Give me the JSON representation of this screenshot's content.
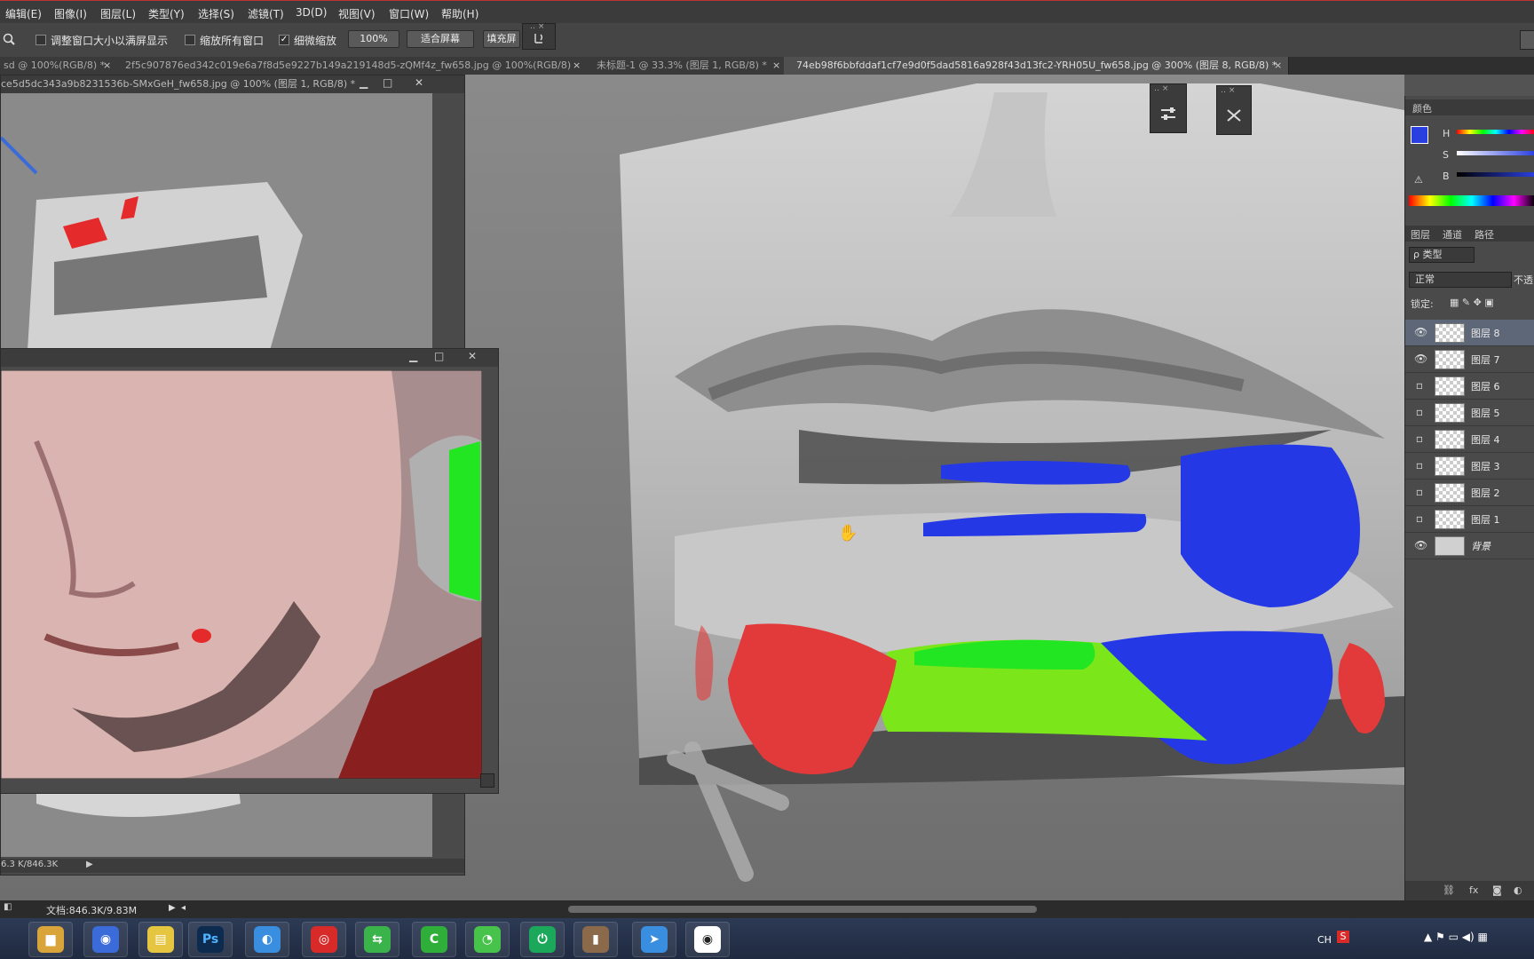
{
  "menu": [
    "编辑(E)",
    "图像(I)",
    "图层(L)",
    "类型(Y)",
    "选择(S)",
    "滤镜(T)",
    "3D(D)",
    "视图(V)",
    "窗口(W)",
    "帮助(H)"
  ],
  "options": {
    "zoom_icon": "zoom-icon",
    "resize_windows": {
      "label": "调整窗口大小以满屏显示",
      "checked": false
    },
    "zoom_all_windows": {
      "label": "缩放所有窗口",
      "checked": false
    },
    "scrubby_zoom": {
      "label": "细微缩放",
      "checked": true
    },
    "zoom_value": "100%",
    "fit_screen": "适合屏幕",
    "fill_screen": "填充屏"
  },
  "tabs": [
    {
      "label": "sd @ 100%(RGB/8) *",
      "close": "×"
    },
    {
      "label": "2f5c907876ed342c019e6a7f8d5e9227b149a219148d5-zQMf4z_fw658.jpg @ 100%(RGB/8)",
      "close": "×"
    },
    {
      "label": "未标题-1 @ 33.3% (图层 1, RGB/8) *",
      "close": "×"
    },
    {
      "label": "74eb98f6bbfddaf1cf7e9d0f5dad5816a928f43d13fc2-YRH05U_fw658.jpg @ 300% (图层 8, RGB/8) *",
      "close": "×"
    }
  ],
  "float_window_1": {
    "title": "ce5d5dc343a9b8231536b-SMxGeH_fw658.jpg @ 100% (图层 1, RGB/8) *",
    "status": "6.3 K/846.3K"
  },
  "float_window_2": {
    "title": ""
  },
  "color_panel": {
    "title": "颜色",
    "channels": [
      "H",
      "S",
      "B"
    ],
    "foreground": "#2a3fe0",
    "background": "#ffffff"
  },
  "layers_panel": {
    "tabs": [
      "图层",
      "通道",
      "路径"
    ],
    "filter": "ρ 类型",
    "blend_mode": "正常",
    "opacity_label": "不透",
    "lock_label": "锁定:",
    "layers": [
      {
        "name": "图层 8",
        "visible": true,
        "selected": true
      },
      {
        "name": "图层 7",
        "visible": true,
        "selected": false
      },
      {
        "name": "图层 6",
        "visible": false,
        "selected": false
      },
      {
        "name": "图层 5",
        "visible": false,
        "selected": false
      },
      {
        "name": "图层 4",
        "visible": false,
        "selected": false
      },
      {
        "name": "图层 3",
        "visible": false,
        "selected": false
      },
      {
        "name": "图层 2",
        "visible": false,
        "selected": false
      },
      {
        "name": "图层 1",
        "visible": false,
        "selected": false
      },
      {
        "name": "背景",
        "visible": true,
        "selected": false
      }
    ],
    "footer_icons": [
      "link-icon",
      "fx-icon",
      "mask-icon",
      "adjustment-icon"
    ]
  },
  "status": {
    "doc": "文档:846.3K/9.83M"
  },
  "taskbar": {
    "apps": [
      {
        "name": "file-explorer",
        "color": "#d9a53a",
        "glyph": "▆"
      },
      {
        "name": "qq",
        "color": "#3a6bd9",
        "glyph": "◉"
      },
      {
        "name": "notepad",
        "color": "#e6c640",
        "glyph": "▤"
      },
      {
        "name": "photoshop",
        "color": "#0d2a4f",
        "glyph": "Ps"
      },
      {
        "name": "browser",
        "color": "#3a8ee0",
        "glyph": "◐"
      },
      {
        "name": "netease-music",
        "color": "#d92a2a",
        "glyph": "◎"
      },
      {
        "name": "sync",
        "color": "#39b34a",
        "glyph": "⇆"
      },
      {
        "name": "camtasia",
        "color": "#2fae3a",
        "glyph": "C"
      },
      {
        "name": "wechat",
        "color": "#47c24a",
        "glyph": "◔"
      },
      {
        "name": "iqiyi",
        "color": "#1ca85a",
        "glyph": "⏻"
      },
      {
        "name": "image-viewer",
        "color": "#8a6a4a",
        "glyph": "▮"
      },
      {
        "name": "feishu",
        "color": "#3a8ee0",
        "glyph": "➤"
      },
      {
        "name": "qq-2",
        "color": "#ffffff",
        "glyph": "◉"
      }
    ],
    "tray_lang": "CH"
  }
}
